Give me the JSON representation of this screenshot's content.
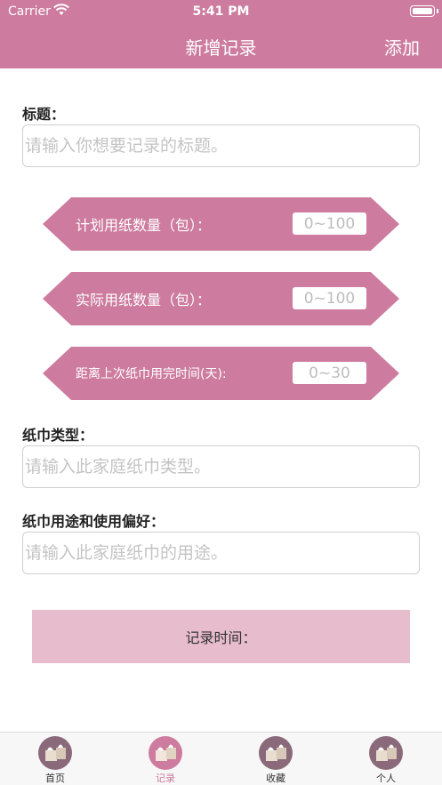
{
  "status_bar": {
    "carrier": "Carrier",
    "time": "5:41 PM"
  },
  "nav": {
    "title": "新增记录",
    "add_label": "添加"
  },
  "title_field": {
    "label": "标题：",
    "placeholder": "请输入你想要记录的标题。"
  },
  "planned_paper": {
    "label": "计划用纸数量（包）：",
    "placeholder": "0~100"
  },
  "actual_paper": {
    "label": "实际用纸数量（包）：",
    "placeholder": "0~100"
  },
  "days_since": {
    "label": "距离上次纸巾用完时间(天):",
    "placeholder": "0~30"
  },
  "tissue_type": {
    "label": "纸巾类型：",
    "placeholder": "请输入此家庭纸巾类型。"
  },
  "tissue_usage": {
    "label": "纸巾用途和使用偏好：",
    "placeholder": "请输入此家庭纸巾的用途。"
  },
  "record_time": {
    "label": "记录时间："
  },
  "tabs": [
    {
      "label": "首页",
      "icon": "tissue-icon"
    },
    {
      "label": "记录",
      "icon": "tissue-icon"
    },
    {
      "label": "收藏",
      "icon": "tissue-icon"
    },
    {
      "label": "个人",
      "icon": "tissue-icon"
    }
  ],
  "colors": {
    "accent": "#cd7b9e",
    "button_light": "#e7bccd"
  }
}
